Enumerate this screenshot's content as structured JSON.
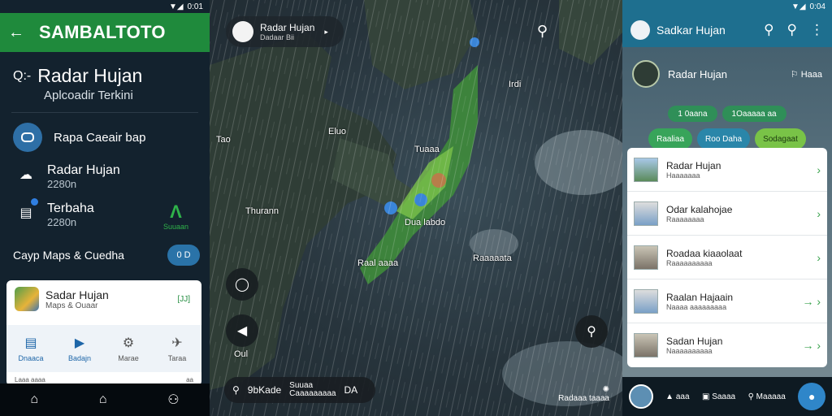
{
  "left": {
    "status_time": "0:01",
    "header_title": "SAMBALTOTO",
    "search_prefix": "Q:-",
    "search_title": "Radar Hujan",
    "search_sub": "Aplcoadir Terkini",
    "row1_label": "Rapa Caeair bap",
    "item1_title": "Radar Hujan",
    "item1_sub": "2280n",
    "item2_title": "Terbaha",
    "item2_sub": "2280n",
    "logo_sub": "Suuaan",
    "maps_label": "Cayp Maps & Cuedha",
    "maps_toggle": "0 D",
    "card_title": "Sadar Hujan",
    "card_sub": "Maps & Ouaar",
    "card_tag": "[JJ]",
    "tabs": [
      "Dnaaca",
      "Badajn",
      "Marae",
      "Taraa"
    ],
    "card_footer_left": "Laaa aaaa",
    "card_footer_right": "aa"
  },
  "mid": {
    "pill_title": "Radar Hujan",
    "pill_sub": "Dadaar Bii",
    "labels": [
      "Tao",
      "Eluo",
      "Irdi",
      "Tuaaa",
      "Thurann",
      "Raal aaaa",
      "Dua labdo",
      "Raaaaata",
      "Oul"
    ],
    "bottom_main": "9bKade",
    "bottom_small1": "Suuaa",
    "bottom_small2": "Caaaaaaaaa",
    "bottom_end": "DA",
    "credit": "Radaaa taaaa"
  },
  "right": {
    "status_time": "0:04",
    "header_title": "Sadkar Hujan",
    "profile_name": "Radar Hujan",
    "profile_side": "Haaa",
    "chips": [
      "1 0aana",
      "1Oaaaaa aa"
    ],
    "buttons": [
      "Raaliaa",
      "Roo Daha",
      "Sodagaat"
    ],
    "items": [
      {
        "title": "Radar Hujan",
        "sub": "Haaaaaaa"
      },
      {
        "title": "Odar kalahojae",
        "sub": "Raaaaaaaa"
      },
      {
        "title": "Roadaa kiaaolaat",
        "sub": "Raaaaaaaaaa"
      },
      {
        "title": "Raalan Hajaain",
        "sub": "Naaaa aaaaaaaaa"
      },
      {
        "title": "Sadan Hujan",
        "sub": "Naaaaaaaaaa"
      }
    ],
    "nav": [
      "aaa",
      "Saaaa",
      "Maaaaa"
    ]
  }
}
